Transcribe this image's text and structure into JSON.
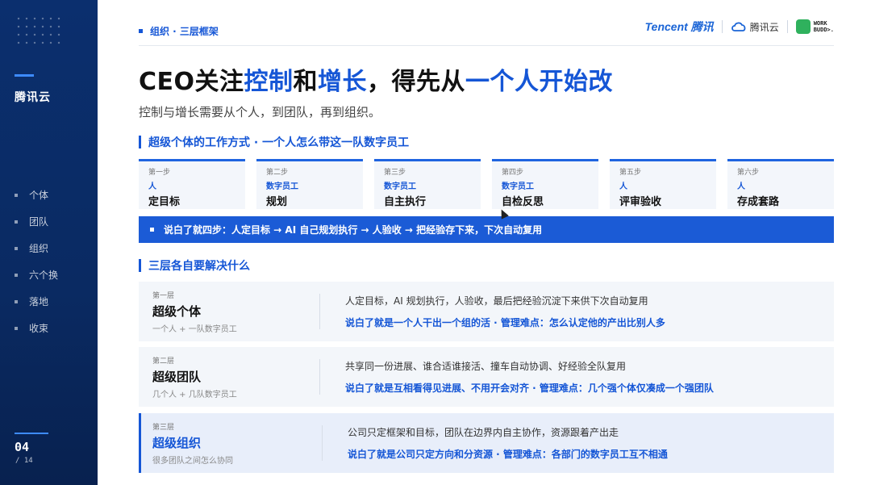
{
  "sidebar": {
    "brand": "腾讯云",
    "nav": [
      "个体",
      "团队",
      "组织",
      "六个换",
      "落地",
      "收束"
    ],
    "page_current": "04",
    "page_total": "/ 14"
  },
  "header": {
    "breadcrumb": "组织 · 三层框架",
    "logo_tencent": "Tencent 腾讯",
    "logo_cloud": "腾讯云",
    "logo_workbuddy_line1": "WORK",
    "logo_workbuddy_line2": "BUDD>."
  },
  "title": {
    "p1": "CEO关注",
    "h1": "控制",
    "p2": "和",
    "h2": "增长",
    "p3": "，得先从",
    "h3": "一个人开始改"
  },
  "subtitle": "控制与增长需要从个人，到团队，再到组织。",
  "section1": "超级个体的工作方式 · 一个人怎么带这一队数字员工",
  "steps": [
    {
      "n": "第一步",
      "who": "人",
      "act": "定目标"
    },
    {
      "n": "第二步",
      "who": "数字员工",
      "act": "规划"
    },
    {
      "n": "第三步",
      "who": "数字员工",
      "act": "自主执行"
    },
    {
      "n": "第四步",
      "who": "数字员工",
      "act": "自检反思"
    },
    {
      "n": "第五步",
      "who": "人",
      "act": "评审验收"
    },
    {
      "n": "第六步",
      "who": "人",
      "act": "存成套路"
    }
  ],
  "banner": "说白了就四步：人定目标 → AI 自己规划执行 → 人验收 → 把经验存下来，下次自动复用",
  "section2": "三层各自要解决什么",
  "layers": [
    {
      "lv": "第一层",
      "name": "超级个体",
      "sub": "一个人 + 一队数字员工",
      "desc": "人定目标，AI 规划执行，人验收，最后把经验沉淀下来供下次自动复用",
      "key": "说白了就是一个人干出一个组的活 · 管理难点：怎么认定他的产出比别人多"
    },
    {
      "lv": "第二层",
      "name": "超级团队",
      "sub": "几个人 + 几队数字员工",
      "desc": "共享同一份进展、谁合适谁接活、撞车自动协调、好经验全队复用",
      "key": "说白了就是互相看得见进展、不用开会对齐 · 管理难点：几个强个体仅凑成一个强团队"
    },
    {
      "lv": "第三层",
      "name": "超级组织",
      "sub": "很多团队之间怎么协同",
      "desc": "公司只定框架和目标，团队在边界内自主协作，资源跟着产出走",
      "key": "说白了就是公司只定方向和分资源 · 管理难点：各部门的数字员工互不相通"
    }
  ],
  "colors": {
    "accent": "#1556d6",
    "sidebar": "#0b2f6e",
    "banner": "#1b5bd6"
  }
}
